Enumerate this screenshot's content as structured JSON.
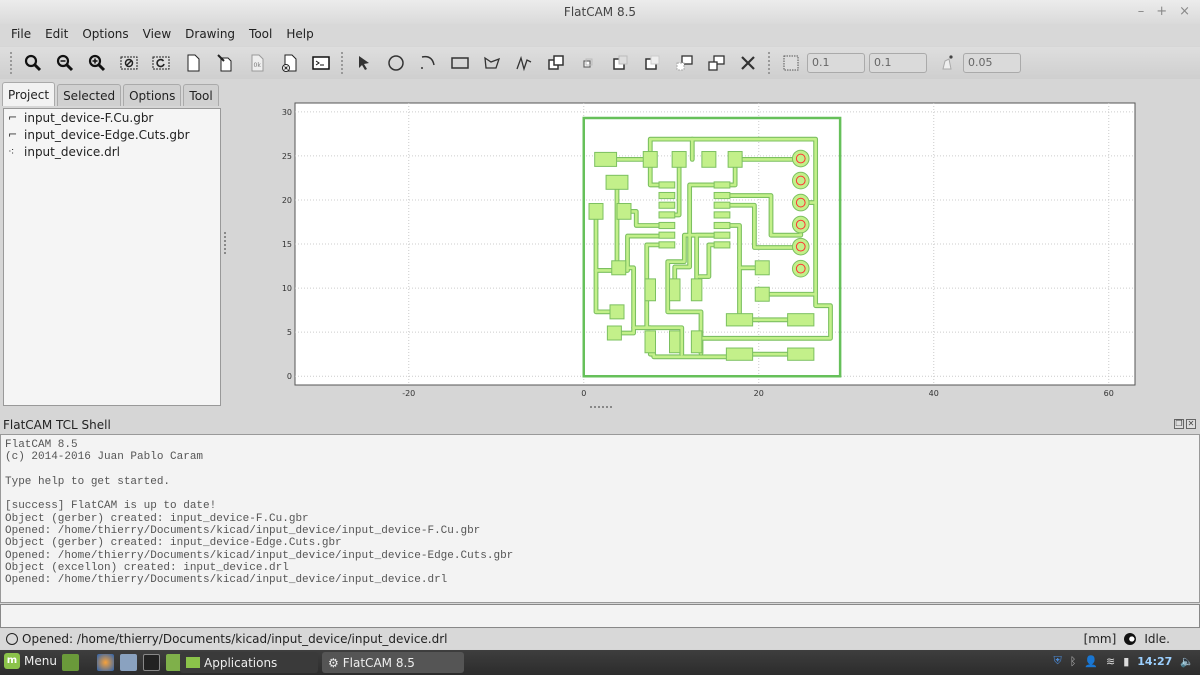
{
  "window": {
    "title": "FlatCAM 8.5",
    "controls": [
      "–",
      "+",
      "×"
    ]
  },
  "menu": [
    "File",
    "Edit",
    "Options",
    "View",
    "Drawing",
    "Tool",
    "Help"
  ],
  "toolbar": {
    "view_tools": [
      "zoom-fit-icon",
      "zoom-out-icon",
      "zoom-in-icon",
      "clear-plot-icon",
      "replot-icon",
      "new-geometry-icon",
      "edit-geometry-icon",
      "update-geometry-icon",
      "delete-object-icon",
      "shell-icon"
    ],
    "draw_tools": [
      "select-icon",
      "circle-icon",
      "arc-icon",
      "rectangle-icon",
      "polygon-icon",
      "path-icon",
      "union-icon",
      "intersection-icon",
      "subtraction-icon",
      "cut-icon",
      "move-icon",
      "copy-icon",
      "delete-shape-icon"
    ],
    "grid_x": "0.1",
    "grid_y": "0.1",
    "snap_max": "0.05"
  },
  "left_panel": {
    "tabs": [
      "Project",
      "Selected",
      "Options",
      "Tool"
    ],
    "active_tab": "Project",
    "objects": [
      {
        "name": "input_device-F.Cu.gbr",
        "type": "gerber"
      },
      {
        "name": "input_device-Edge.Cuts.gbr",
        "type": "gerber"
      },
      {
        "name": "input_device.drl",
        "type": "excellon"
      }
    ]
  },
  "plot": {
    "x_ticks": [
      "-20",
      "0",
      "20",
      "40",
      "60"
    ],
    "y_ticks": [
      "0",
      "5",
      "10",
      "15",
      "20",
      "25",
      "30"
    ],
    "xlim": [
      -33,
      63
    ],
    "ylim": [
      -1,
      31
    ],
    "copper_fill": "#c3f08a",
    "copper_edge": "#7cc060",
    "outline_color": "#66c05a",
    "drill_color": "#ff3333",
    "board_outline": [
      [
        0,
        0
      ],
      [
        29.3,
        0
      ],
      [
        29.3,
        29.3
      ],
      [
        0,
        29.3
      ]
    ],
    "pads": [
      [
        2.5,
        24.6,
        2.5,
        1.6
      ],
      [
        7.6,
        24.6,
        1.6,
        1.8
      ],
      [
        10.9,
        24.6,
        1.6,
        1.8
      ],
      [
        14.3,
        24.6,
        1.6,
        1.8
      ],
      [
        17.3,
        24.6,
        1.6,
        1.8
      ],
      [
        3.8,
        22.0,
        2.5,
        1.6
      ],
      [
        1.4,
        18.7,
        1.6,
        1.8
      ],
      [
        4.6,
        18.7,
        1.6,
        1.8
      ],
      [
        4.0,
        12.3,
        1.6,
        1.6
      ],
      [
        3.8,
        7.3,
        1.6,
        1.6
      ],
      [
        3.5,
        4.9,
        1.6,
        1.6
      ],
      [
        7.6,
        3.9,
        1.2,
        2.5
      ],
      [
        10.4,
        3.9,
        1.2,
        2.5
      ],
      [
        12.9,
        3.9,
        1.2,
        2.5
      ],
      [
        7.6,
        9.8,
        1.2,
        2.5
      ],
      [
        10.4,
        9.8,
        1.2,
        2.5
      ],
      [
        12.9,
        9.8,
        1.2,
        2.5
      ],
      [
        20.4,
        12.3,
        1.6,
        1.6
      ],
      [
        20.4,
        9.3,
        1.6,
        1.6
      ],
      [
        17.8,
        6.4,
        3.0,
        1.4
      ],
      [
        24.8,
        6.4,
        3.0,
        1.4
      ],
      [
        17.8,
        2.5,
        3.0,
        1.4
      ],
      [
        24.8,
        2.5,
        3.0,
        1.4
      ],
      [
        9.5,
        21.7,
        1.8,
        0.7
      ],
      [
        9.5,
        20.5,
        1.8,
        0.7
      ],
      [
        9.5,
        19.4,
        1.8,
        0.7
      ],
      [
        9.5,
        18.3,
        1.8,
        0.7
      ],
      [
        9.5,
        17.1,
        1.8,
        0.7
      ],
      [
        9.5,
        16.0,
        1.8,
        0.7
      ],
      [
        9.5,
        14.9,
        1.8,
        0.7
      ],
      [
        15.8,
        21.7,
        1.8,
        0.7
      ],
      [
        15.8,
        20.5,
        1.8,
        0.7
      ],
      [
        15.8,
        19.4,
        1.8,
        0.7
      ],
      [
        15.8,
        18.3,
        1.8,
        0.7
      ],
      [
        15.8,
        17.1,
        1.8,
        0.7
      ],
      [
        15.8,
        16.0,
        1.8,
        0.7
      ],
      [
        15.8,
        14.9,
        1.8,
        0.7
      ]
    ],
    "drills": [
      [
        24.8,
        24.7
      ],
      [
        24.8,
        22.2
      ],
      [
        24.8,
        19.7
      ],
      [
        24.8,
        17.2
      ],
      [
        24.8,
        14.7
      ],
      [
        24.8,
        12.2
      ]
    ],
    "traces": [
      [
        [
          3.6,
          24.6
        ],
        [
          7.6,
          24.6
        ]
      ],
      [
        [
          7.6,
          24.6
        ],
        [
          7.6,
          26.9
        ],
        [
          26.5,
          26.9
        ],
        [
          26.5,
          19.7
        ],
        [
          24.8,
          19.7
        ]
      ],
      [
        [
          12.4,
          26.9
        ],
        [
          12.4,
          24.6
        ]
      ],
      [
        [
          17.3,
          24.6
        ],
        [
          24.8,
          24.6
        ]
      ],
      [
        [
          7.6,
          24.6
        ],
        [
          7.6,
          21.7
        ],
        [
          9.5,
          21.7
        ]
      ],
      [
        [
          17.3,
          24.6
        ],
        [
          17.3,
          21.7
        ],
        [
          15.8,
          21.7
        ]
      ],
      [
        [
          3.8,
          21.5
        ],
        [
          3.8,
          12.0
        ],
        [
          1.4,
          12.0
        ]
      ],
      [
        [
          1.4,
          18.0
        ],
        [
          1.4,
          7.3
        ],
        [
          3.8,
          7.3
        ]
      ],
      [
        [
          4.6,
          18.7
        ],
        [
          6.0,
          18.7
        ],
        [
          6.0,
          17.1
        ],
        [
          9.5,
          17.1
        ]
      ],
      [
        [
          10.9,
          24.6
        ],
        [
          10.9,
          18.3
        ],
        [
          9.5,
          18.3
        ]
      ],
      [
        [
          4.4,
          12.3
        ],
        [
          5.7,
          12.3
        ],
        [
          5.7,
          4.9
        ],
        [
          3.5,
          4.9
        ]
      ],
      [
        [
          3.8,
          12.0
        ],
        [
          5.0,
          12.0
        ],
        [
          5.0,
          15.9
        ],
        [
          9.5,
          15.9
        ]
      ],
      [
        [
          9.5,
          14.9
        ],
        [
          7.2,
          14.9
        ],
        [
          7.2,
          5.5
        ],
        [
          11.2,
          5.5
        ],
        [
          11.2,
          2.5
        ]
      ],
      [
        [
          5.7,
          5.5
        ],
        [
          7.6,
          5.5
        ]
      ],
      [
        [
          15.8,
          20.5
        ],
        [
          21.4,
          20.5
        ],
        [
          21.4,
          16.0
        ],
        [
          24.8,
          16.0
        ],
        [
          24.8,
          17.2
        ]
      ],
      [
        [
          15.8,
          19.4
        ],
        [
          19.5,
          19.4
        ],
        [
          19.5,
          14.6
        ],
        [
          24.8,
          14.6
        ],
        [
          24.8,
          14.7
        ]
      ],
      [
        [
          15.8,
          21.7
        ],
        [
          12.1,
          21.7
        ],
        [
          12.1,
          12.4
        ],
        [
          10.4,
          12.4
        ],
        [
          10.4,
          11.0
        ]
      ],
      [
        [
          15.8,
          16.0
        ],
        [
          12.9,
          16.0
        ],
        [
          12.9,
          11.0
        ]
      ],
      [
        [
          15.8,
          14.9
        ],
        [
          14.3,
          14.9
        ],
        [
          14.3,
          11.3
        ],
        [
          13.2,
          11.3
        ]
      ],
      [
        [
          15.8,
          17.1
        ],
        [
          17.8,
          17.1
        ],
        [
          17.8,
          12.3
        ],
        [
          20.4,
          12.3
        ]
      ],
      [
        [
          17.8,
          12.3
        ],
        [
          17.8,
          6.4
        ]
      ],
      [
        [
          20.4,
          9.3
        ],
        [
          26.5,
          9.3
        ],
        [
          26.5,
          8.0
        ],
        [
          28.2,
          8.0
        ],
        [
          28.2,
          4.3
        ],
        [
          12.9,
          4.3
        ]
      ],
      [
        [
          17.8,
          6.4
        ],
        [
          24.8,
          6.4
        ]
      ],
      [
        [
          17.8,
          2.5
        ],
        [
          24.8,
          2.5
        ]
      ],
      [
        [
          7.6,
          2.5
        ],
        [
          8.0,
          2.5
        ],
        [
          8.0,
          2.2
        ],
        [
          17.8,
          2.2
        ]
      ],
      [
        [
          15.8,
          16.0
        ],
        [
          11.5,
          16.0
        ],
        [
          11.5,
          13.0
        ],
        [
          9.6,
          13.0
        ],
        [
          9.6,
          7.3
        ],
        [
          13.4,
          7.3
        ],
        [
          13.4,
          2.6
        ]
      ],
      [
        [
          26.5,
          19.7
        ],
        [
          26.5,
          9.3
        ]
      ]
    ]
  },
  "shell": {
    "title": "FlatCAM TCL Shell",
    "lines": [
      "FlatCAM 8.5",
      "(c) 2014-2016 Juan Pablo Caram",
      "",
      "Type help to get started.",
      "",
      "[success] FlatCAM is up to date!",
      "Object (gerber) created: input_device-F.Cu.gbr",
      "Opened: /home/thierry/Documents/kicad/input_device/input_device-F.Cu.gbr",
      "Object (gerber) created: input_device-Edge.Cuts.gbr",
      "Opened: /home/thierry/Documents/kicad/input_device/input_device-Edge.Cuts.gbr",
      "Object (excellon) created: input_device.drl",
      "Opened: /home/thierry/Documents/kicad/input_device/input_device.drl"
    ],
    "input_value": ""
  },
  "status": {
    "message": "Opened: /home/thierry/Documents/kicad/input_device/input_device.drl",
    "units": "[mm]",
    "state": "Idle."
  },
  "taskbar": {
    "menu_label": "Menu",
    "windows": [
      "Applications",
      "FlatCAM 8.5"
    ],
    "clock": "14:27"
  }
}
